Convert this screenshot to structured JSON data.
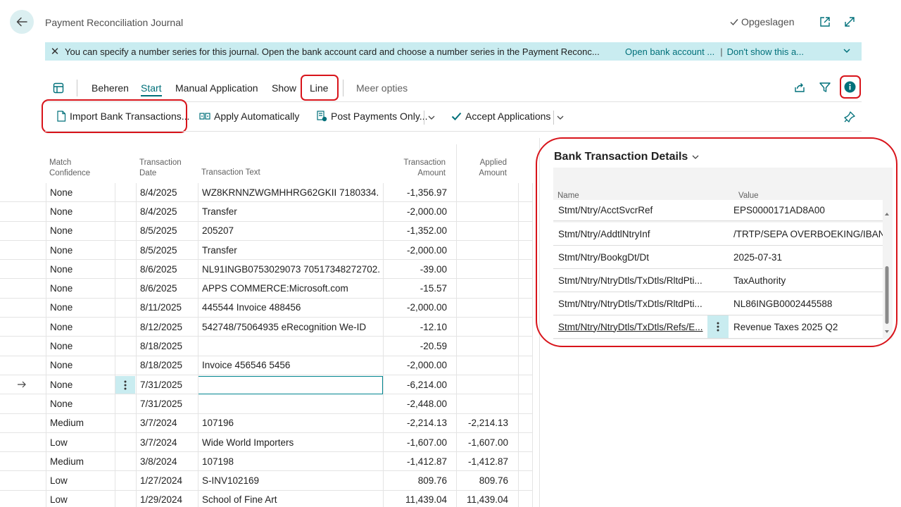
{
  "header": {
    "title": "Payment Reconciliation Journal",
    "saved_label": "Opgeslagen"
  },
  "banner": {
    "message": "You can specify a number series for this journal. Open the bank account card and choose a number series in the Payment Reconc...",
    "link_open": "Open bank account ...",
    "separator": "|",
    "link_dont_show": "Don't show this a..."
  },
  "menu": {
    "beheren": "Beheren",
    "start": "Start",
    "manual_application": "Manual Application",
    "show": "Show",
    "line": "Line",
    "more": "Meer opties"
  },
  "toolbar": {
    "import": "Import Bank Transactions...",
    "apply_auto": "Apply Automatically",
    "post_payments": "Post Payments Only...",
    "accept": "Accept Applications"
  },
  "table": {
    "headers": {
      "match1": "Match",
      "match2": "Confidence",
      "date1": "Transaction",
      "date2": "Date",
      "text": "Transaction Text",
      "amount1": "Transaction",
      "amount2": "Amount",
      "applied1": "Applied",
      "applied2": "Amount"
    },
    "rows": [
      {
        "match": "None",
        "date": "8/4/2025",
        "text": "WZ8KRNNZWGMHHRG62GKII 7180334...",
        "amount": "-1,356.97",
        "applied": ""
      },
      {
        "match": "None",
        "date": "8/4/2025",
        "text": "Transfer",
        "amount": "-2,000.00",
        "applied": ""
      },
      {
        "match": "None",
        "date": "8/5/2025",
        "text": "205207",
        "amount": "-1,352.00",
        "applied": ""
      },
      {
        "match": "None",
        "date": "8/5/2025",
        "text": "Transfer",
        "amount": "-2,000.00",
        "applied": ""
      },
      {
        "match": "None",
        "date": "8/6/2025",
        "text": "NL91INGB0753029073 70517348272702...",
        "amount": "-39.00",
        "applied": ""
      },
      {
        "match": "None",
        "date": "8/6/2025",
        "text": "APPS COMMERCE:Microsoft.com",
        "amount": "-15.57",
        "applied": ""
      },
      {
        "match": "None",
        "date": "8/11/2025",
        "text": "445544 Invoice 488456",
        "amount": "-2,000.00",
        "applied": ""
      },
      {
        "match": "None",
        "date": "8/12/2025",
        "text": "542748/75064935 eRecognition We-ID",
        "amount": "-12.10",
        "applied": ""
      },
      {
        "match": "None",
        "date": "8/18/2025",
        "text": "",
        "amount": "-20.59",
        "applied": ""
      },
      {
        "match": "None",
        "date": "8/18/2025",
        "text": "Invoice 456546 5456",
        "amount": "-2,000.00",
        "applied": ""
      },
      {
        "match": "None",
        "date": "7/31/2025",
        "text": "",
        "amount": "-6,214.00",
        "applied": ""
      },
      {
        "match": "None",
        "date": "7/31/2025",
        "text": "",
        "amount": "-2,448.00",
        "applied": ""
      },
      {
        "match": "Medium",
        "date": "3/7/2024",
        "text": "107196",
        "amount": "-2,214.13",
        "applied": "-2,214.13"
      },
      {
        "match": "Low",
        "date": "3/7/2024",
        "text": "Wide World Importers",
        "amount": "-1,607.00",
        "applied": "-1,607.00"
      },
      {
        "match": "Medium",
        "date": "3/8/2024",
        "text": "107198",
        "amount": "-1,412.87",
        "applied": "-1,412.87"
      },
      {
        "match": "Low",
        "date": "1/27/2024",
        "text": "S-INV102169",
        "amount": "809.76",
        "applied": "809.76"
      },
      {
        "match": "Low",
        "date": "1/29/2024",
        "text": "School of Fine Art",
        "amount": "11,439.04",
        "applied": "11,439.04"
      }
    ]
  },
  "details": {
    "title": "Bank Transaction Details",
    "col_name": "Name",
    "col_value": "Value",
    "rows": [
      {
        "name": "Stmt/Ntry/AcctSvcrRef",
        "value": "EPS0000171AD8A00"
      },
      {
        "name": "Stmt/Ntry/AddtlNtryInf",
        "value": "/TRTP/SEPA OVERBOEKING/IBAN..."
      },
      {
        "name": "Stmt/Ntry/BookgDt/Dt",
        "value": "2025-07-31"
      },
      {
        "name": "Stmt/Ntry/NtryDtls/TxDtls/RltdPti...",
        "value": "TaxAuthority"
      },
      {
        "name": "Stmt/Ntry/NtryDtls/TxDtls/RltdPti...",
        "value": "NL86INGB0002445588"
      },
      {
        "name": "Stmt/Ntry/NtryDtls/TxDtls/Refs/E...",
        "value": "Revenue Taxes 2025 Q2"
      }
    ]
  },
  "colors": {
    "accent": "#00707a",
    "banner": "#c9ecf0",
    "highlight": "#d8141b"
  }
}
